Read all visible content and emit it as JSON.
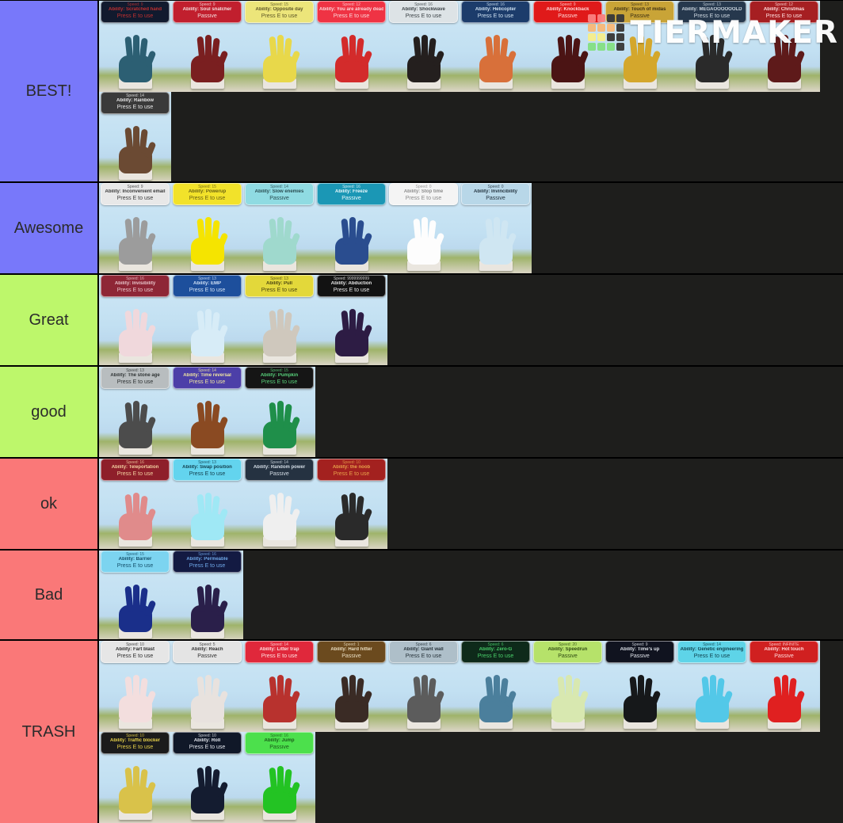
{
  "watermark": {
    "text": "TIERMAKER",
    "colors": [
      "#f98080",
      "#f98080",
      "#3a3a3a",
      "#3a3a3a",
      "#f7b97a",
      "#f7b97a",
      "#f7b97a",
      "#3a3a3a",
      "#f6ef8c",
      "#f6ef8c",
      "#3a3a3a",
      "#3a3a3a",
      "#86e085",
      "#86e085",
      "#86e085",
      "#3a3a3a"
    ]
  },
  "tiers": [
    {
      "label": "BEST!",
      "color": "#7878fa",
      "items": [
        {
          "stat": "Speed: 9",
          "ability": "Ability: Scratched hand",
          "use": "Press E to use",
          "card_bg": "#111a2e",
          "card_fg": "#c03030",
          "hand": "#2c5f73"
        },
        {
          "stat": "Speed: 9",
          "ability": "Ability: Soul snatcher",
          "use": "Passive",
          "card_bg": "#c11f2e",
          "card_fg": "#f3dcdc",
          "hand": "#7a1f20"
        },
        {
          "stat": "Speed: 15",
          "ability": "Ability: Opposite day",
          "use": "Press E to use",
          "card_bg": "#ece57a",
          "card_fg": "#5e5728",
          "hand": "#e8d84a"
        },
        {
          "stat": "Speed: 12",
          "ability": "Ability: You are already dead",
          "use": "Press E to use",
          "card_bg": "#ef3344",
          "card_fg": "#fbd6d9",
          "hand": "#d32b2b"
        },
        {
          "stat": "Speed: 16",
          "ability": "Ability: Shockwave",
          "use": "Press E to use",
          "card_bg": "#dde3e6",
          "card_fg": "#3b4246",
          "hand": "#241f1e"
        },
        {
          "stat": "Speed: 16",
          "ability": "Ability: Helicopter",
          "use": "Press E to use",
          "card_bg": "#1c3c6b",
          "card_fg": "#cfe2f2",
          "hand": "#d8703a"
        },
        {
          "stat": "Speed: 9",
          "ability": "Ability: Knockback",
          "use": "Passive",
          "card_bg": "#e01a1a",
          "card_fg": "#ffd7d7",
          "hand": "#4b1414"
        },
        {
          "stat": "Speed: 13",
          "ability": "Ability: Touch of midas",
          "use": "Passive",
          "card_bg": "#c9a437",
          "card_fg": "#3e3114",
          "hand": "#d4a72c"
        },
        {
          "stat": "Speed: 13",
          "ability": "Ability: MEGAOOOOOOLD",
          "use": "Press E to use",
          "card_bg": "#26384d",
          "card_fg": "#cfd9e2",
          "hand": "#2a2a2a"
        },
        {
          "stat": "Speed: 12",
          "ability": "Ability: Christmas",
          "use": "Press E to use",
          "card_bg": "#a61f22",
          "card_fg": "#ffdede",
          "hand": "#5e1a1a"
        },
        {
          "stat": "Speed: 14",
          "ability": "Ability: Rainbow",
          "use": "Press E to use",
          "card_bg": "#3a3a3a",
          "card_fg": "#e9e9e9",
          "hand": "#6b4a33"
        }
      ]
    },
    {
      "label": "Awesome",
      "color": "#7878fa",
      "items": [
        {
          "stat": "Speed: 9",
          "ability": "Ability: Inconvenient email",
          "use": "Press E to use",
          "card_bg": "#e8e8e8",
          "card_fg": "#3b3b3b",
          "hand": "#9c9c9c"
        },
        {
          "stat": "Speed: 15",
          "ability": "Ability: Powerup",
          "use": "Press E to use",
          "card_bg": "#f2e22a",
          "card_fg": "#6b6214",
          "hand": "#f5e400"
        },
        {
          "stat": "Speed: 14",
          "ability": "Ability: Slow enemies",
          "use": "Passive",
          "card_bg": "#8fdbe2",
          "card_fg": "#2a4e52",
          "hand": "#9fd9cd"
        },
        {
          "stat": "Speed: 16",
          "ability": "Ability: Freeze",
          "use": "Passive",
          "card_bg": "#1b97b5",
          "card_fg": "#eaf8fb",
          "hand": "#2a4d8f"
        },
        {
          "stat": "Speed: 0",
          "ability": "Ability: Stop time",
          "use": "Press E to use",
          "card_bg": "#f4f4f4",
          "card_fg": "#8c8c8c",
          "hand": "#fdfdfd"
        },
        {
          "stat": "Speed: 0",
          "ability": "Ability: Invincibility",
          "use": "Passive",
          "card_bg": "#b8d7e8",
          "card_fg": "#243440",
          "hand": "#cfe6f2"
        }
      ]
    },
    {
      "label": "Great",
      "color": "#bdf76b",
      "items": [
        {
          "stat": "Speed: 16",
          "ability": "Ability: Invisibility",
          "use": "Press E to use",
          "card_bg": "#8e2636",
          "card_fg": "#e8c4ca",
          "hand": "#f0d8dc"
        },
        {
          "stat": "Speed: 13",
          "ability": "Ability: EMP",
          "use": "Press E to use",
          "card_bg": "#1d4f9c",
          "card_fg": "#cfe0f5",
          "hand": "#d7ecf7"
        },
        {
          "stat": "Speed: 13",
          "ability": "Ability: Pull",
          "use": "Press E to use",
          "card_bg": "#e3d83a",
          "card_fg": "#4a4510",
          "hand": "#cfc8bd"
        },
        {
          "stat": "Speed: 9999999999",
          "ability": "Ability: Abduction",
          "use": "Press E to use",
          "card_bg": "#121212",
          "card_fg": "#e8e8e8",
          "hand": "#2d1c44"
        }
      ]
    },
    {
      "label": "good",
      "color": "#bdf76b",
      "items": [
        {
          "stat": "Speed: 13",
          "ability": "Ability: The stone age",
          "use": "Press E to use",
          "card_bg": "#b8bdbf",
          "card_fg": "#2e3334",
          "hand": "#4c4c4c"
        },
        {
          "stat": "Speed: 14",
          "ability": "Ability: Time reversal",
          "use": "Press E to use",
          "card_bg": "#4c3fa8",
          "card_fg": "#f0e6a0",
          "hand": "#8a4a22"
        },
        {
          "stat": "Speed: 15",
          "ability": "Ability: Pumpkin",
          "use": "Press E to use",
          "card_bg": "#151515",
          "card_fg": "#57d07a",
          "hand": "#1f8f4a"
        }
      ]
    },
    {
      "label": "ok",
      "color": "#fa7878",
      "items": [
        {
          "stat": "Speed: 16",
          "ability": "Ability: Teleportation",
          "use": "Press E to use",
          "card_bg": "#8e1f2a",
          "card_fg": "#f3d0a0",
          "hand": "#e08b8b"
        },
        {
          "stat": "Speed: 13",
          "ability": "Ability: Swap position",
          "use": "Press E to use",
          "card_bg": "#63d4ee",
          "card_fg": "#123e4c",
          "hand": "#9fe8f5"
        },
        {
          "stat": "Speed: 14",
          "ability": "Ability: Random power",
          "use": "Passive",
          "card_bg": "#253241",
          "card_fg": "#d4dde6",
          "hand": "#efefef"
        },
        {
          "stat": "Speed: 10",
          "ability": "Ability: the noob",
          "use": "Press E to use",
          "card_bg": "#a3211f",
          "card_fg": "#e8a14a",
          "hand": "#2a2a2a"
        }
      ]
    },
    {
      "label": "Bad",
      "color": "#fa7878",
      "items": [
        {
          "stat": "Speed: 15",
          "ability": "Ability: Barrier",
          "use": "Press E to use",
          "card_bg": "#7cd4f0",
          "card_fg": "#15506b",
          "hand": "#1a2f8a"
        },
        {
          "stat": "Speed: 16",
          "ability": "Ability: Permeable",
          "use": "Press E to use",
          "card_bg": "#131a42",
          "card_fg": "#6fa8e8",
          "hand": "#2a1f4a"
        }
      ]
    },
    {
      "label": "TRASH",
      "color": "#fa7878",
      "items": [
        {
          "stat": "Speed: 10",
          "ability": "Ability: Fart blast",
          "use": "Press E to use",
          "card_bg": "#e6e6e6",
          "card_fg": "#2f2f2f",
          "hand": "#f3dede"
        },
        {
          "stat": "Speed: 5",
          "ability": "Ability: Reach",
          "use": "Passive",
          "card_bg": "#e4e4e4",
          "card_fg": "#333333",
          "hand": "#e8e2de"
        },
        {
          "stat": "Speed: 14",
          "ability": "Ability: Litter trap",
          "use": "Press E to use",
          "card_bg": "#e0283b",
          "card_fg": "#ffe0e0",
          "hand": "#b8322e"
        },
        {
          "stat": "Speed: 1",
          "ability": "Ability: Hard hitter",
          "use": "Passive",
          "card_bg": "#6b4a1e",
          "card_fg": "#e8dcc0",
          "hand": "#3a2b25"
        },
        {
          "stat": "Speed: 6",
          "ability": "Ability: Giant wall",
          "use": "Press E to use",
          "card_bg": "#aebfc9",
          "card_fg": "#27333a",
          "hand": "#5c5c5c"
        },
        {
          "stat": "Speed: 6",
          "ability": "Ability: Zero-G",
          "use": "Press E to use",
          "card_bg": "#0e2a1a",
          "card_fg": "#49d06a",
          "hand": "#4b7f9c"
        },
        {
          "stat": "Speed: 20",
          "ability": "Ability: Speedrun",
          "use": "Passive",
          "card_bg": "#b6e26a",
          "card_fg": "#2f4a12",
          "hand": "#d8e8b0"
        },
        {
          "stat": "Speed: 9",
          "ability": "Ability: Time's up",
          "use": "Passive",
          "card_bg": "#10131f",
          "card_fg": "#dfe3ea",
          "hand": "#16181a"
        },
        {
          "stat": "Speed: 14",
          "ability": "Ability: Genetic engineering",
          "use": "Press E to use",
          "card_bg": "#5ed4e8",
          "card_fg": "#10434f",
          "hand": "#53c8e8"
        },
        {
          "stat": "Speed: INFINITE",
          "ability": "Ability: Hot touch",
          "use": "Passive",
          "card_bg": "#d02020",
          "card_fg": "#ffdada",
          "hand": "#e02020"
        },
        {
          "stat": "Speed: 10",
          "ability": "Ability: Traffic blocker",
          "use": "Press E to use",
          "card_bg": "#1b1b1b",
          "card_fg": "#e8d24a",
          "hand": "#d9c24a"
        },
        {
          "stat": "Speed: 10",
          "ability": "Ability: Roll",
          "use": "Press E to use",
          "card_bg": "#101828",
          "card_fg": "#e4e8ef",
          "hand": "#141c30"
        },
        {
          "stat": "Speed: 16",
          "ability": "Ability: Jump",
          "use": "Passive",
          "card_bg": "#4ce04c",
          "card_fg": "#1a5a1a",
          "hand": "#23c323"
        }
      ]
    }
  ]
}
